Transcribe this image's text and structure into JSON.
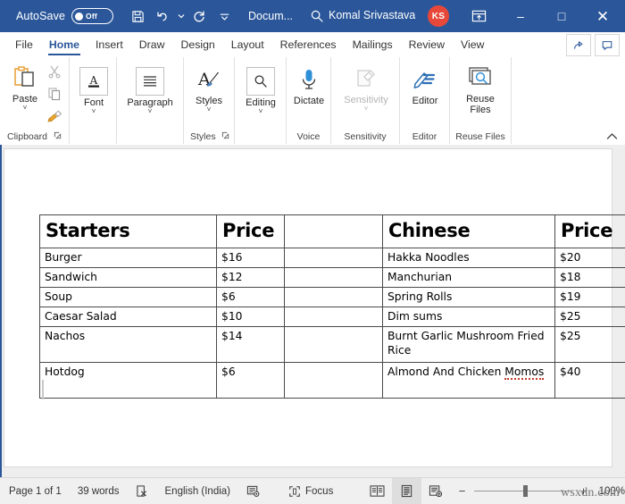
{
  "titlebar": {
    "autosave_label": "AutoSave",
    "autosave_state": "Off",
    "save_icon": "save-icon",
    "undo_icon": "undo-icon",
    "redo_icon": "redo-icon",
    "customize_icon": "customize-quick-access-toolbar-icon",
    "document_name": "Docum...",
    "search_icon": "search-icon",
    "user_name": "Komal Srivastava",
    "user_initials": "KS",
    "ribbon_display_icon": "ribbon-display-options-icon",
    "minimize_label": "–",
    "maximize_label": "□",
    "close_label": "✕",
    "bg_color": "#2b579a",
    "avatar_color": "#e8483a"
  },
  "tabs": [
    {
      "label": "File",
      "active": false
    },
    {
      "label": "Home",
      "active": true
    },
    {
      "label": "Insert",
      "active": false
    },
    {
      "label": "Draw",
      "active": false
    },
    {
      "label": "Design",
      "active": false
    },
    {
      "label": "Layout",
      "active": false
    },
    {
      "label": "References",
      "active": false
    },
    {
      "label": "Mailings",
      "active": false
    },
    {
      "label": "Review",
      "active": false
    },
    {
      "label": "View",
      "active": false
    }
  ],
  "tab_right_buttons": [
    {
      "name": "share-icon"
    },
    {
      "name": "comments-icon"
    }
  ],
  "ribbon": {
    "accent_color": "#2b579a",
    "collapse_label": "⌃",
    "groups": [
      {
        "name": "clipboard",
        "label": "Clipboard",
        "has_dialog_launcher": true,
        "items": [
          {
            "label": "Paste",
            "icon": "paste-icon",
            "caret": true
          },
          {
            "label": "",
            "icon": "cut-icon",
            "caret": false
          },
          {
            "label": "",
            "icon": "copy-icon",
            "caret": false
          },
          {
            "label": "",
            "icon": "format-painter-icon",
            "caret": false
          }
        ]
      },
      {
        "name": "font",
        "label": "",
        "has_dialog_launcher": false,
        "items": [
          {
            "label": "Font",
            "icon": "font-icon",
            "caret": true
          }
        ]
      },
      {
        "name": "paragraph",
        "label": "",
        "has_dialog_launcher": false,
        "items": [
          {
            "label": "Paragraph",
            "icon": "paragraph-icon",
            "caret": true
          }
        ]
      },
      {
        "name": "styles",
        "label": "Styles",
        "has_dialog_launcher": true,
        "items": [
          {
            "label": "Styles",
            "icon": "styles-icon",
            "caret": true
          }
        ]
      },
      {
        "name": "editing",
        "label": "",
        "has_dialog_launcher": false,
        "items": [
          {
            "label": "Editing",
            "icon": "editing-icon",
            "caret": true
          }
        ]
      },
      {
        "name": "voice",
        "label": "Voice",
        "has_dialog_launcher": false,
        "items": [
          {
            "label": "Dictate",
            "icon": "dictate-microphone-icon",
            "caret": false
          }
        ]
      },
      {
        "name": "sensitivity",
        "label": "Sensitivity",
        "has_dialog_launcher": false,
        "items": [
          {
            "label": "Sensitivity",
            "icon": "sensitivity-icon",
            "caret": true,
            "disabled": true
          }
        ]
      },
      {
        "name": "editor",
        "label": "Editor",
        "has_dialog_launcher": false,
        "items": [
          {
            "label": "Editor",
            "icon": "editor-pen-icon",
            "caret": false
          }
        ]
      },
      {
        "name": "reuse-files",
        "label": "Reuse Files",
        "has_dialog_launcher": false,
        "items": [
          {
            "label": "Reuse Files",
            "icon": "reuse-files-icon",
            "caret": false
          }
        ]
      }
    ]
  },
  "document": {
    "table": {
      "headers": [
        "Starters",
        "Price",
        "",
        "Chinese",
        "Price"
      ],
      "rows": [
        [
          "Burger",
          "$16",
          "",
          "Hakka Noodles",
          "$20"
        ],
        [
          "Sandwich",
          "$12",
          "",
          "Manchurian",
          "$18"
        ],
        [
          "Soup",
          "$6",
          "",
          "Spring Rolls",
          "$19"
        ],
        [
          "Caesar Salad",
          "$10",
          "",
          "Dim sums",
          "$25"
        ],
        [
          "Nachos",
          "$14",
          "",
          "Burnt Garlic Mushroom Fried Rice",
          "$25"
        ],
        [
          "Hotdog",
          "$6",
          "",
          "Almond And Chicken Momos",
          "$40"
        ]
      ],
      "misspelled_words": [
        "Momos"
      ]
    }
  },
  "statusbar": {
    "page_label": "Page 1 of 1",
    "word_count": "39 words",
    "proofing_icon": "proofing-errors-icon",
    "language": "English (India)",
    "accessibility_icon": "accessibility-checker-icon",
    "focus_label": "Focus",
    "focus_icon": "focus-mode-icon",
    "views": [
      {
        "name": "read-mode-view-button",
        "selected": false
      },
      {
        "name": "print-layout-view-button",
        "selected": true
      },
      {
        "name": "web-layout-view-button",
        "selected": false
      }
    ],
    "zoom_out_label": "−",
    "zoom_in_label": "+",
    "zoom_percent": "100%",
    "watermark": "wsxdn.com"
  }
}
